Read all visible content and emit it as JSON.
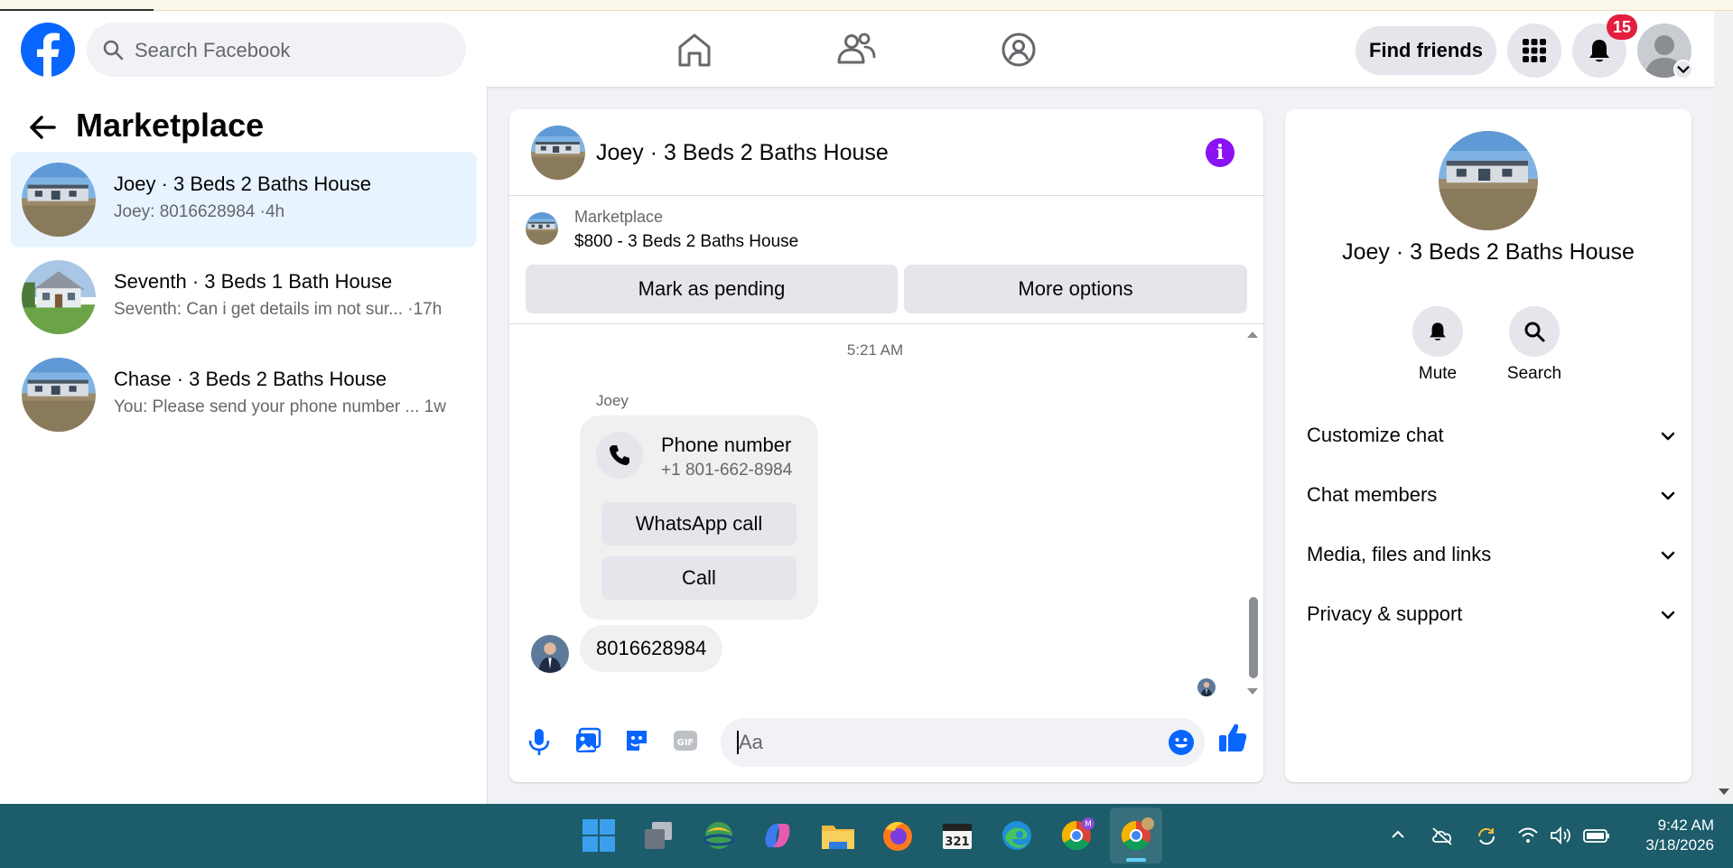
{
  "header": {
    "search_placeholder": "Search Facebook",
    "find_friends": "Find friends",
    "notification_count": "15",
    "nav_icons": [
      "home-icon",
      "friends-icon",
      "groups-icon"
    ]
  },
  "sidebar": {
    "title": "Marketplace",
    "conversations": [
      {
        "name": "Joey · 3 Beds 2 Baths House",
        "preview": "Joey: 8016628984 ·4h",
        "active": true
      },
      {
        "name": "Seventh · 3 Beds 1 Bath House",
        "preview": "Seventh: Can i get details im not sur...  ·17h",
        "active": false
      },
      {
        "name": "Chase · 3 Beds 2 Baths House",
        "preview": "You: Please send your phone number ...  1w",
        "active": false
      }
    ]
  },
  "chat": {
    "title": "Joey · 3 Beds 2 Baths House",
    "listing_label": "Marketplace",
    "listing_price": "$800 - 3 Beds 2 Baths House",
    "mark_pending": "Mark as pending",
    "more_options": "More options",
    "timestamp": "5:21 AM",
    "sender": "Joey",
    "contact_card": {
      "title": "Phone number",
      "number": "+1 801-662-8984",
      "whatsapp_call": "WhatsApp call",
      "call": "Call"
    },
    "reply_message": "8016628984",
    "input_placeholder": "Aa"
  },
  "details": {
    "title": "Joey · 3 Beds 2 Baths House",
    "mute": "Mute",
    "search": "Search",
    "sections": [
      "Customize chat",
      "Chat members",
      "Media, files and links",
      "Privacy & support"
    ]
  },
  "taskbar": {
    "time": "9:42 AM",
    "date": "3/18/2026",
    "apps": [
      "windows-start",
      "task-view",
      "browser-globe",
      "copilot",
      "file-explorer",
      "firefox",
      "video-editor",
      "edge",
      "chrome-profile-m",
      "chrome-active"
    ]
  },
  "colors": {
    "brand_blue": "#0866ff",
    "active_row": "#e7f3ff",
    "badge_red": "#e41e3f",
    "info_purple": "#8a12f5",
    "taskbar": "#1c5c6b"
  }
}
